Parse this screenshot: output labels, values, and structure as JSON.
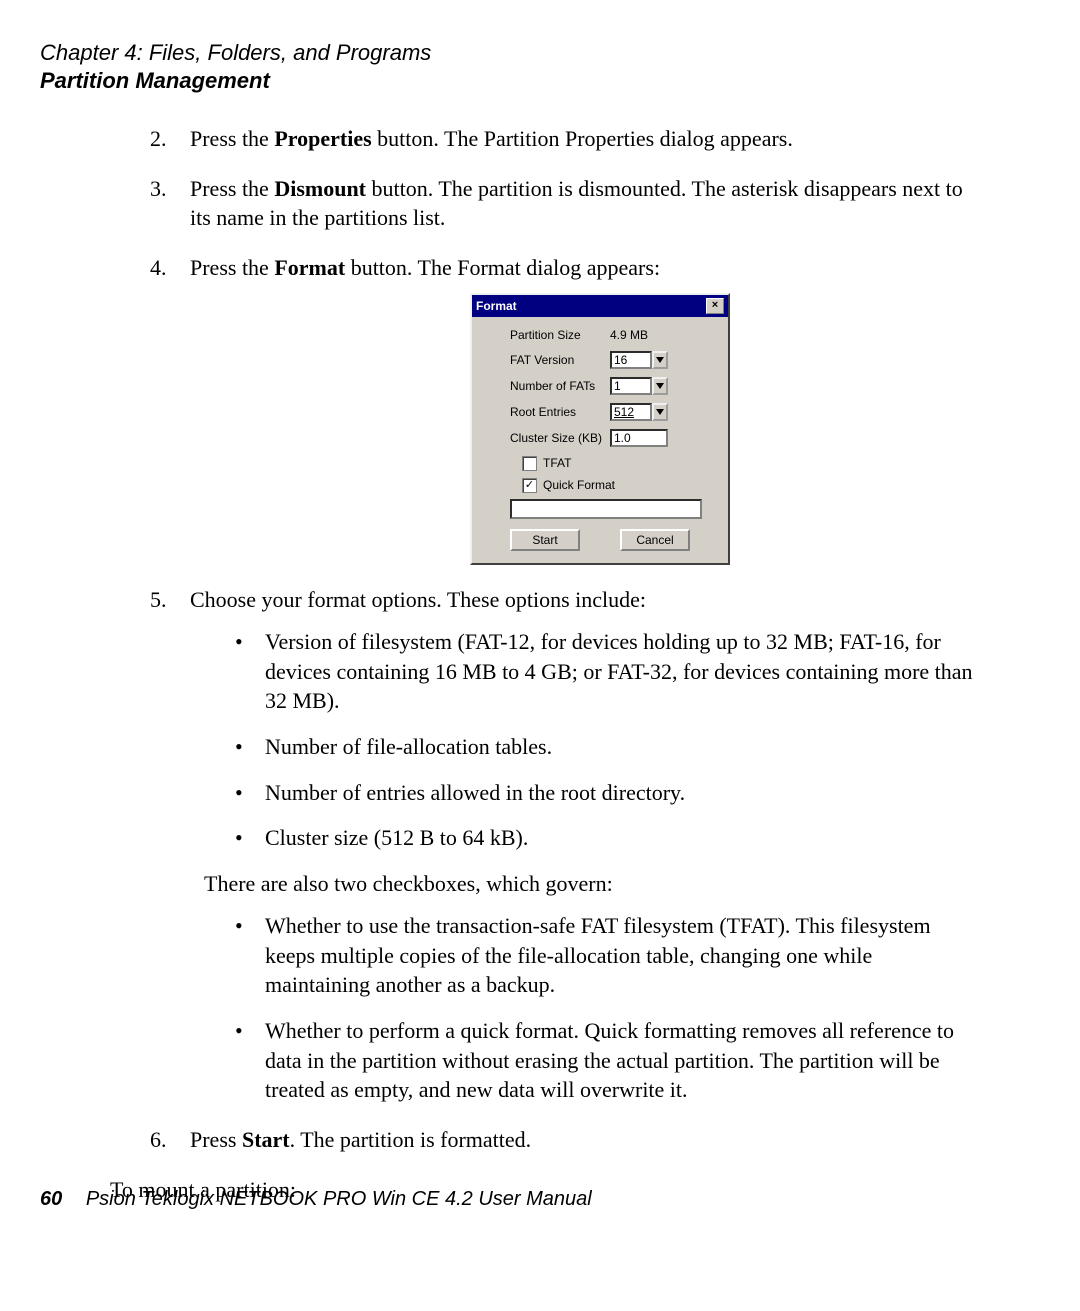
{
  "header": {
    "chapter": "Chapter 4:  Files, Folders, and Programs",
    "section": "Partition Management"
  },
  "steps": {
    "s2": {
      "num": "2.",
      "pre": "Press the ",
      "bold": "Properties",
      "post": " button. The Partition Properties dialog appears."
    },
    "s3": {
      "num": "3.",
      "pre": "Press the ",
      "bold": "Dismount",
      "post": " button. The partition is dismounted. The asterisk disappears next to its name in the partitions list."
    },
    "s4": {
      "num": "4.",
      "pre": "Press the ",
      "bold": "Format",
      "post": " button. The Format dialog appears:"
    },
    "s5": {
      "num": "5.",
      "text": "Choose your format options. These options include:"
    },
    "s6": {
      "num": "6.",
      "pre": "Press ",
      "bold": "Start",
      "post": ". The partition is formatted."
    }
  },
  "dialog": {
    "title": "Format",
    "close_glyph": "×",
    "rows": {
      "partition_size": {
        "label": "Partition Size",
        "value": "4.9 MB"
      },
      "fat_version": {
        "label": "FAT Version",
        "value": "16"
      },
      "num_fats": {
        "label": "Number of FATs",
        "value": "1"
      },
      "root_entries": {
        "label": "Root Entries",
        "value": "512"
      },
      "cluster_size": {
        "label": "Cluster Size (KB)",
        "value": "1.0"
      }
    },
    "checkboxes": {
      "tfat": {
        "label": "TFAT",
        "checked_glyph": ""
      },
      "quick": {
        "label": "Quick Format",
        "checked_glyph": "✓"
      }
    },
    "buttons": {
      "start": "Start",
      "cancel": "Cancel"
    }
  },
  "optlist": {
    "b1": "Version of filesystem (FAT-12, for devices holding up to 32 MB; FAT-16, for devices containing 16 MB to 4 GB; or FAT-32, for devices containing more than 32 MB).",
    "b2": "Number of file-allocation tables.",
    "b3": "Number of entries allowed in the root directory.",
    "b4": "Cluster size (512 B to 64 kB)."
  },
  "cb_intro": "There are also two checkboxes, which govern:",
  "cblist": {
    "c1": "Whether to use the transaction-safe FAT filesystem (TFAT). This filesystem keeps multiple copies of the file-allocation table, changing one while maintaining another as a backup.",
    "c2": "Whether to perform a quick format. Quick formatting removes all reference to data in the partition without erasing the actual partition. The partition will be treated as empty, and new data will overwrite it."
  },
  "outro": "To mount a partition:",
  "footer": {
    "page": "60",
    "manual": "Psion Teklogix NETBOOK PRO Win CE 4.2 User Manual"
  }
}
